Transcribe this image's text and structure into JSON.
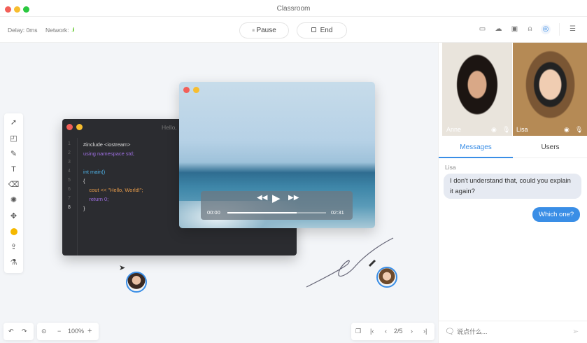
{
  "window": {
    "title": "Classroom"
  },
  "toolbar": {
    "delay": "Delay: 0ms",
    "network_label": "Network:",
    "pause_label": "Pause",
    "end_label": "End",
    "icons": [
      "video-camera-icon",
      "cloud-icon",
      "screen-share-icon",
      "add-user-icon",
      "record-icon",
      "menu-icon"
    ]
  },
  "tools": [
    "cursor-icon",
    "sticky-note-icon",
    "pen-icon",
    "text-icon",
    "eraser-icon",
    "laser-icon",
    "move-icon",
    "color-icon",
    "upload-icon",
    "clear-icon"
  ],
  "tool_color": "#f5b800",
  "code_window": {
    "title": "Hello,",
    "lines": [
      {
        "n": "1",
        "text": "#include <iostream>"
      },
      {
        "n": "2",
        "text": "using namespace std;"
      },
      {
        "n": "3",
        "text": ""
      },
      {
        "n": "4",
        "text": "int main()"
      },
      {
        "n": "5",
        "text": "{"
      },
      {
        "n": "6",
        "text": "    cout << \"Hello, World!\";"
      },
      {
        "n": "7",
        "text": "    return 0;"
      },
      {
        "n": "8",
        "text": "}"
      }
    ]
  },
  "video_player": {
    "current": "00:00",
    "duration": "02:31",
    "progress": 0.7
  },
  "participants": [
    {
      "name": "Anne"
    },
    {
      "name": "Lisa"
    }
  ],
  "tabs": {
    "messages": "Messages",
    "users": "Users",
    "active": "Messages"
  },
  "chat": {
    "messages": [
      {
        "sender": "Lisa",
        "text": "I don't understand that, could you explain it again?",
        "own": false
      },
      {
        "text": "Which one?",
        "own": true
      }
    ],
    "placeholder": "说点什么..."
  },
  "bottom": {
    "zoom": "100%",
    "page": "2/5"
  },
  "accent": "#3a8ee6"
}
